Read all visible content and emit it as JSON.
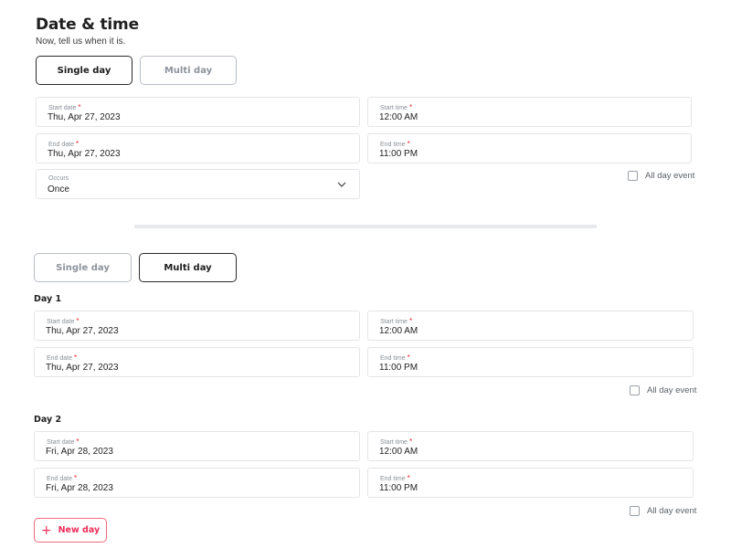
{
  "header": {
    "title": "Date & time",
    "subtitle": "Now, tell us when it is."
  },
  "single_view": {
    "toggle": {
      "single": "Single day",
      "multi": "Multi day",
      "selected": "Single day"
    },
    "start_date": {
      "label": "Start date",
      "value": "Thu, Apr 27, 2023"
    },
    "start_time": {
      "label": "Start time",
      "value": "12:00 AM"
    },
    "end_date": {
      "label": "End date",
      "value": "Thu, Apr 27, 2023"
    },
    "end_time": {
      "label": "End time",
      "value": "11:00 PM"
    },
    "occurs": {
      "label": "Occurs",
      "value": "Once"
    },
    "all_day": {
      "label": "All day event",
      "checked": false
    }
  },
  "multi_view": {
    "toggle": {
      "single": "Single day",
      "multi": "Multi day",
      "selected": "Multi day"
    },
    "days": [
      {
        "title": "Day 1",
        "start_date": {
          "label": "Start date",
          "value": "Thu, Apr 27, 2023"
        },
        "start_time": {
          "label": "Start time",
          "value": "12:00 AM"
        },
        "end_date": {
          "label": "End date",
          "value": "Thu, Apr 27, 2023"
        },
        "end_time": {
          "label": "End time",
          "value": "11:00 PM"
        },
        "all_day": {
          "label": "All day event",
          "checked": false
        }
      },
      {
        "title": "Day 2",
        "start_date": {
          "label": "Start date",
          "value": "Fri, Apr 28, 2023"
        },
        "start_time": {
          "label": "Start time",
          "value": "12:00 AM"
        },
        "end_date": {
          "label": "End date",
          "value": "Fri, Apr 28, 2023"
        },
        "end_time": {
          "label": "End time",
          "value": "11:00 PM"
        },
        "all_day": {
          "label": "All day event",
          "checked": false
        }
      }
    ],
    "new_day_button": {
      "icon": "plus-icon",
      "label": "New day"
    }
  },
  "required_marker": "*",
  "colors": {
    "accent": "#ee2e5a",
    "required": "#e8232f",
    "border": "#e3e5e8"
  }
}
